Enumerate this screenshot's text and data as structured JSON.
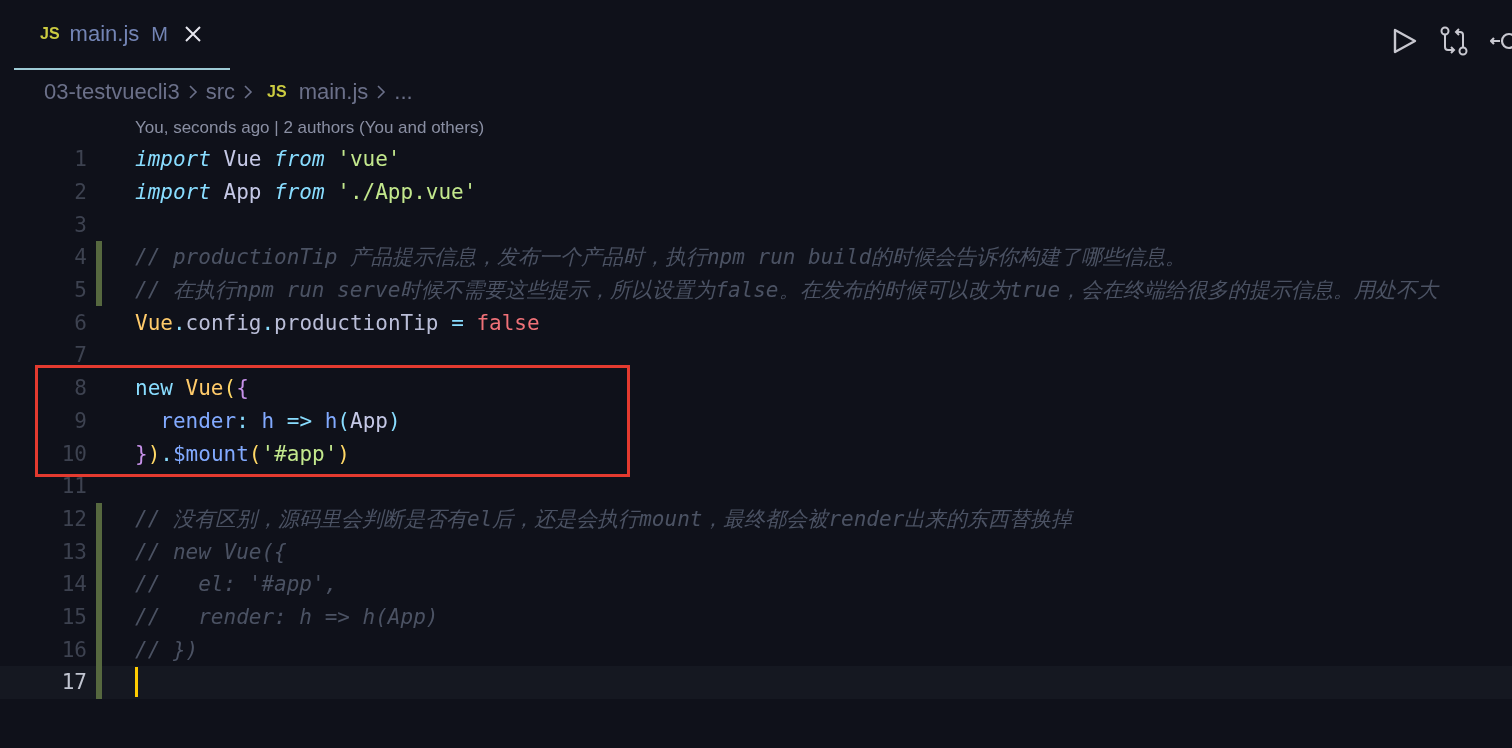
{
  "tab": {
    "icon_text": "JS",
    "label": "main.js",
    "badge": "M",
    "selected": true
  },
  "breadcrumbs": [
    {
      "label": "03-testvuecli3"
    },
    {
      "label": "src"
    },
    {
      "icon_text": "JS",
      "label": "main.js"
    },
    {
      "label": "..."
    }
  ],
  "blame": "You, seconds ago | 2 authors (You and others)",
  "lines": [
    {
      "number": "1",
      "modified": false,
      "highlighted": false,
      "current": false,
      "tokens": [
        {
          "text": "import",
          "kind": "kw"
        },
        {
          "text": " Vue ",
          "kind": "id"
        },
        {
          "text": "from",
          "kind": "kw"
        },
        {
          "text": " 'vue'",
          "kind": "str"
        }
      ]
    },
    {
      "number": "2",
      "modified": false,
      "highlighted": false,
      "current": false,
      "tokens": [
        {
          "text": "import",
          "kind": "kw"
        },
        {
          "text": " App ",
          "kind": "id"
        },
        {
          "text": "from",
          "kind": "kw"
        },
        {
          "text": " './App.vue'",
          "kind": "str"
        }
      ]
    },
    {
      "number": "3",
      "modified": false,
      "highlighted": false,
      "current": false
    },
    {
      "number": "4",
      "modified": true,
      "highlighted": false,
      "current": false,
      "tokens": [
        {
          "text": "// productionTip 产品提示信息，发布一个产品时，执行npm run build的时候会告诉你构建了哪些信息。",
          "kind": "cmt"
        }
      ]
    },
    {
      "number": "5",
      "modified": true,
      "highlighted": false,
      "current": false,
      "tokens": [
        {
          "text": "// 在执行npm run serve时候不需要这些提示，所以设置为false。在发布的时候可以改为true，会在终端给很多的提示信息。用处不大",
          "kind": "cmt"
        }
      ]
    },
    {
      "number": "6",
      "modified": false,
      "highlighted": false,
      "current": false,
      "tokens": [
        {
          "text": "Vue",
          "kind": "cls"
        },
        {
          "text": ".",
          "kind": "op"
        },
        {
          "text": "config",
          "kind": "plain"
        },
        {
          "text": ".",
          "kind": "op"
        },
        {
          "text": "productionTip ",
          "kind": "plain"
        },
        {
          "text": "=",
          "kind": "op"
        },
        {
          "text": " false",
          "kind": "bool"
        }
      ]
    },
    {
      "number": "7",
      "modified": false,
      "highlighted": false,
      "current": false
    },
    {
      "number": "8",
      "modified": false,
      "highlighted": true,
      "current": false,
      "tokens": [
        {
          "text": "new ",
          "kind": "op"
        },
        {
          "text": "Vue",
          "kind": "cls"
        },
        {
          "text": "(",
          "kind": "paren"
        },
        {
          "text": "{",
          "kind": "brace"
        }
      ]
    },
    {
      "number": "9",
      "modified": false,
      "highlighted": true,
      "current": false,
      "tokens": [
        {
          "text": "  render",
          "kind": "fn"
        },
        {
          "text": ": ",
          "kind": "op"
        },
        {
          "text": "h ",
          "kind": "fn"
        },
        {
          "text": "=>",
          "kind": "op"
        },
        {
          "text": " h",
          "kind": "fn"
        },
        {
          "text": "(",
          "kind": "op"
        },
        {
          "text": "App",
          "kind": "id"
        },
        {
          "text": ")",
          "kind": "op"
        }
      ]
    },
    {
      "number": "10",
      "modified": false,
      "highlighted": true,
      "current": false,
      "tokens": [
        {
          "text": "}",
          "kind": "brace"
        },
        {
          "text": ")",
          "kind": "paren"
        },
        {
          "text": ".",
          "kind": "op"
        },
        {
          "text": "$mount",
          "kind": "fn"
        },
        {
          "text": "(",
          "kind": "paren"
        },
        {
          "text": "'#app'",
          "kind": "str"
        },
        {
          "text": ")",
          "kind": "paren"
        }
      ]
    },
    {
      "number": "11",
      "modified": false,
      "highlighted": false,
      "current": false
    },
    {
      "number": "12",
      "modified": true,
      "highlighted": false,
      "current": false,
      "tokens": [
        {
          "text": "// 没有区别，源码里会判断是否有el后，还是会执行mount，最终都会被render出来的东西替换掉",
          "kind": "cmt"
        }
      ]
    },
    {
      "number": "13",
      "modified": true,
      "highlighted": false,
      "current": false,
      "tokens": [
        {
          "text": "// new Vue({",
          "kind": "cmt"
        }
      ]
    },
    {
      "number": "14",
      "modified": true,
      "highlighted": false,
      "current": false,
      "tokens": [
        {
          "text": "//   el: '#app',",
          "kind": "cmt"
        }
      ]
    },
    {
      "number": "15",
      "modified": true,
      "highlighted": false,
      "current": false,
      "tokens": [
        {
          "text": "//   render: h => h(App)",
          "kind": "cmt"
        }
      ]
    },
    {
      "number": "16",
      "modified": true,
      "highlighted": false,
      "current": false,
      "tokens": [
        {
          "text": "// })",
          "kind": "cmt"
        }
      ]
    },
    {
      "number": "17",
      "modified": true,
      "highlighted": false,
      "current": true
    }
  ]
}
